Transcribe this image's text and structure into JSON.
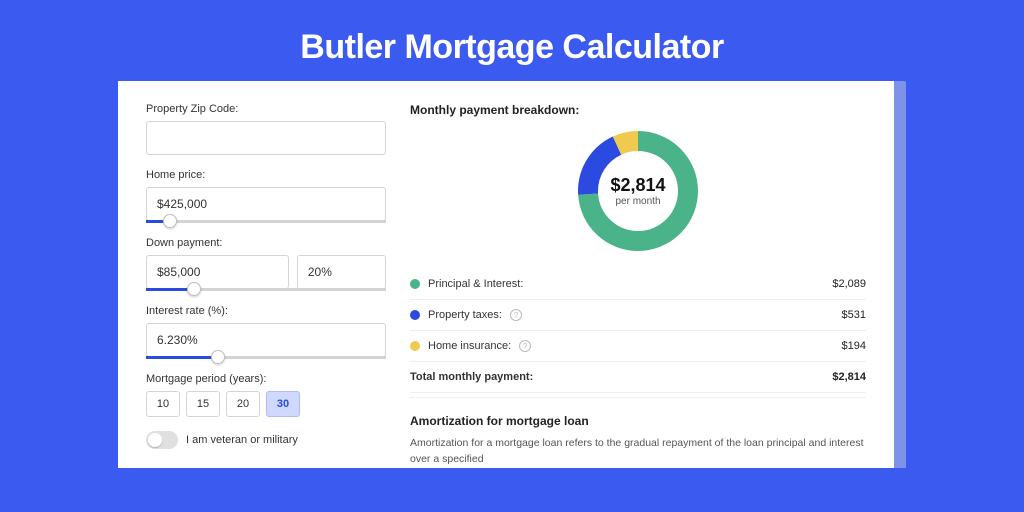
{
  "hero": {
    "title": "Butler Mortgage Calculator"
  },
  "form": {
    "zip": {
      "label": "Property Zip Code:",
      "value": ""
    },
    "home_price": {
      "label": "Home price:",
      "value": "$425,000",
      "slider_pct": 10
    },
    "down_payment": {
      "label": "Down payment:",
      "value": "$85,000",
      "pct_value": "20%",
      "slider_pct": 20
    },
    "interest": {
      "label": "Interest rate (%):",
      "value": "6.230%",
      "slider_pct": 30
    },
    "period": {
      "label": "Mortgage period (years):",
      "options": [
        "10",
        "15",
        "20",
        "30"
      ],
      "selected": "30"
    },
    "veteran": {
      "label": "I am veteran or military",
      "on": false
    }
  },
  "breakdown": {
    "title": "Monthly payment breakdown:",
    "center_value": "$2,814",
    "center_sub": "per month",
    "items": [
      {
        "label": "Principal & Interest:",
        "value": "$2,089",
        "color": "#4bb38a",
        "pct": 74,
        "info": false
      },
      {
        "label": "Property taxes:",
        "value": "$531",
        "color": "#2a4ae0",
        "pct": 19,
        "info": true
      },
      {
        "label": "Home insurance:",
        "value": "$194",
        "color": "#f0c94f",
        "pct": 7,
        "info": true
      }
    ],
    "total": {
      "label": "Total monthly payment:",
      "value": "$2,814"
    }
  },
  "amortization": {
    "title": "Amortization for mortgage loan",
    "text": "Amortization for a mortgage loan refers to the gradual repayment of the loan principal and interest over a specified"
  },
  "chart_data": {
    "type": "pie",
    "title": "Monthly payment breakdown",
    "series": [
      {
        "name": "Principal & Interest",
        "value": 2089,
        "color": "#4bb38a"
      },
      {
        "name": "Property taxes",
        "value": 531,
        "color": "#2a4ae0"
      },
      {
        "name": "Home insurance",
        "value": 194,
        "color": "#f0c94f"
      }
    ],
    "total": 2814,
    "center_label": "$2,814 per month"
  }
}
